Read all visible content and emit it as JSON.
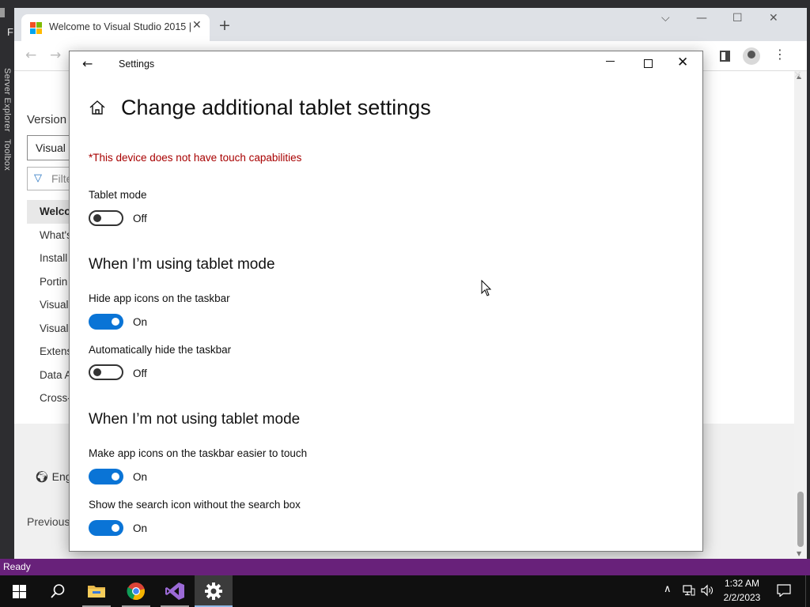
{
  "vs": {
    "menu_initial": "F",
    "server_explorer_label": "Server Explorer",
    "toolbox_label": "Toolbox",
    "status_text": "Ready"
  },
  "browser": {
    "tab_title": "Welcome to Visual Studio 2015 |",
    "new_tab": "+",
    "page": {
      "version_label": "Version",
      "version_select": "Visual",
      "filter_placeholder": "Filte",
      "nav_items": [
        "Welco",
        "What's",
        "Install",
        "Portin",
        "Visual",
        "Visual",
        "Extens",
        "Data A",
        "Cross-"
      ],
      "language": "Eng",
      "previous": "Previous"
    }
  },
  "settings": {
    "window_title": "Settings",
    "page_title": "Change additional tablet settings",
    "warning": "*This device does not have touch capabilities",
    "tablet_mode": {
      "label": "Tablet mode",
      "state": "Off"
    },
    "using_heading": "When I’m using tablet mode",
    "hide_icons": {
      "label": "Hide app icons on the taskbar",
      "state": "On"
    },
    "auto_hide": {
      "label": "Automatically hide the taskbar",
      "state": "Off"
    },
    "not_using_heading": "When I’m not using tablet mode",
    "easier_touch": {
      "label": "Make app icons on the taskbar easier to touch",
      "state": "On"
    },
    "search_icon": {
      "label": "Show the search icon without the search box",
      "state": "On"
    }
  },
  "taskbar": {
    "time": "1:32 AM",
    "date": "2/2/2023",
    "apps": [
      "start-icon",
      "search-icon",
      "file-explorer-icon",
      "chrome-icon",
      "visual-studio-icon",
      "settings-gear-icon"
    ]
  },
  "colors": {
    "accent": "#0a74d6",
    "warning": "#a80000",
    "vs_status": "#68217a",
    "taskbar": "#101010"
  }
}
